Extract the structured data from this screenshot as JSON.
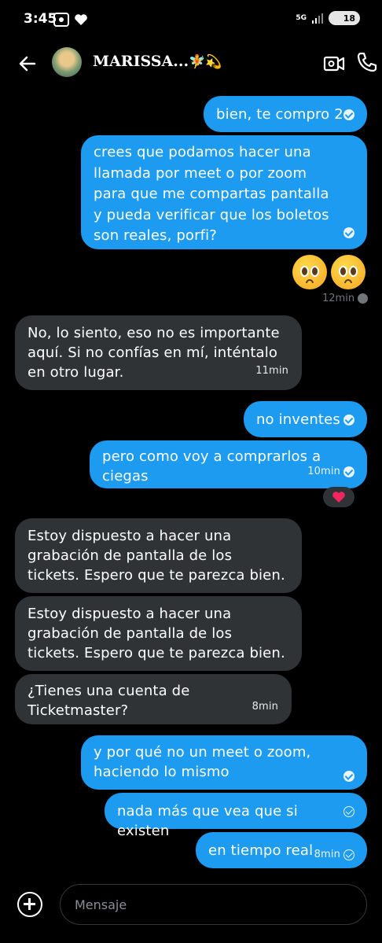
{
  "status": {
    "time": "3:45",
    "network": "5G",
    "battery": "18"
  },
  "header": {
    "contact_name": "MARISSA...",
    "name_emojis": "🧚💫"
  },
  "messages": [
    {
      "dir": "out",
      "text": "bien, te compro 2",
      "time": "",
      "status": "read"
    },
    {
      "dir": "out",
      "text": "crees que podamos hacer una llamada por meet o por zoom para que me compartas pantalla y pueda verificar que los boletos son reales, porfi?",
      "time": "",
      "status": "read"
    },
    {
      "dir": "out",
      "text": "🥺🥺",
      "time": "12min",
      "status": "read"
    },
    {
      "dir": "in",
      "text": "No, lo siento, eso no es importante aquí. Si no confías en mí, inténtalo en otro lugar.",
      "time": "11min"
    },
    {
      "dir": "out",
      "text": "no inventes",
      "time": "",
      "status": "read"
    },
    {
      "dir": "out",
      "text": "pero como voy a comprarlos a ciegas",
      "time": "10min",
      "status": "read"
    },
    {
      "dir": "in",
      "text": "Estoy dispuesto a hacer una grabación de pantalla de los tickets. Espero que te parezca bien.",
      "time": ""
    },
    {
      "dir": "in",
      "text": "Estoy dispuesto a hacer una grabación de pantalla de los tickets. Espero que te parezca bien.",
      "time": ""
    },
    {
      "dir": "in",
      "text": "¿Tienes una cuenta de Ticketmaster?",
      "time": "8min"
    },
    {
      "dir": "out",
      "text": "y por qué no un meet o zoom, haciendo lo mismo",
      "time": "",
      "status": "read"
    },
    {
      "dir": "out",
      "text": "nada más que vea que si existen",
      "time": "",
      "status": "sent"
    },
    {
      "dir": "out",
      "text": "en tiempo real",
      "time": "8min",
      "status": "sent"
    }
  ],
  "reaction": "❤️",
  "composer": {
    "placeholder": "Mensaje"
  },
  "colors": {
    "outgoing_bubble": "#1d9bf0",
    "incoming_bubble": "#2f3336",
    "background": "#000000"
  },
  "icons": [
    "back-arrow-icon",
    "video-icon",
    "phone-icon",
    "add-circle-icon",
    "heart-icon"
  ]
}
